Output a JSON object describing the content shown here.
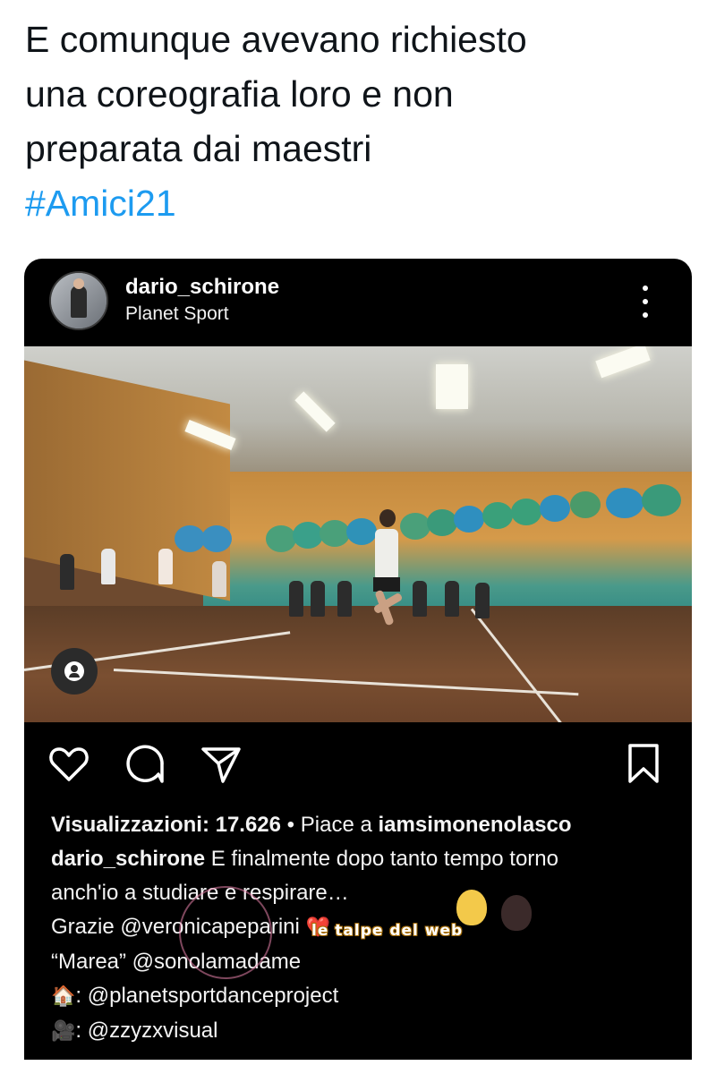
{
  "tweet": {
    "line1": "E comunque avevano richiesto",
    "line2": "una coreografia loro e non",
    "line3": "preparata dai maestri",
    "hashtag": "#Amici21",
    "hashtag_color": "#1d9bf0"
  },
  "post": {
    "username": "dario_schirone",
    "location": "Planet Sport",
    "more_icon": "more-vertical-icon",
    "media_icons": [
      "tag-person-icon"
    ],
    "action_icons": [
      "heart-icon",
      "comment-icon",
      "share-icon",
      "bookmark-icon"
    ]
  },
  "caption": {
    "views_label": "Visualizzazioni: 17.626",
    "separator": " • Piace a ",
    "liked_by": "iamsimonenolasco",
    "author": "dario_schirone",
    "text1": " E finalmente dopo tanto tempo torno",
    "text2": "anch'io a studiare e respirare…",
    "text3": "Grazie @veronicapeparini",
    "heart_emoji": "❤️",
    "text4": "“Marea” @sonolamadame",
    "house_emoji": "🏠",
    "text5": ": @planetsportdanceproject",
    "camera_emoji": "🎥",
    "text6": ": @zzyzxvisual"
  },
  "watermark": {
    "text": "le talpe del web"
  }
}
